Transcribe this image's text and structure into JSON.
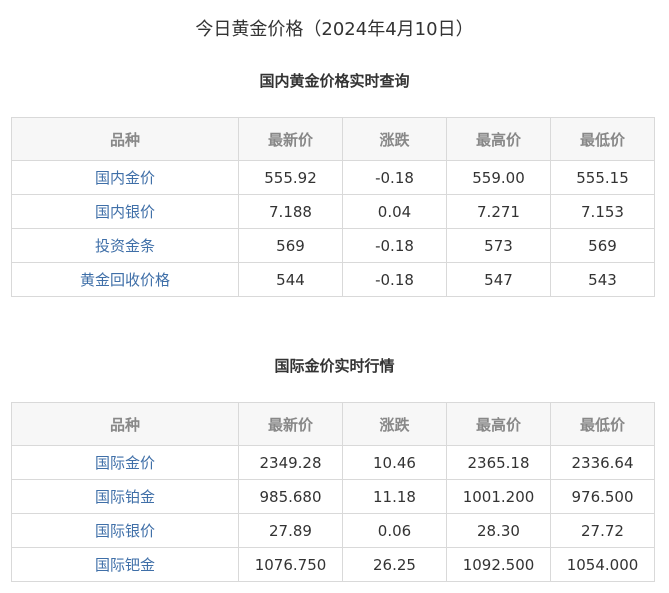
{
  "page_title": "今日黄金价格（2024年4月10日）",
  "domestic": {
    "title": "国内黄金价格实时查询",
    "headers": [
      "品种",
      "最新价",
      "涨跌",
      "最高价",
      "最低价"
    ],
    "rows": [
      [
        "国内金价",
        "555.92",
        "-0.18",
        "559.00",
        "555.15"
      ],
      [
        "国内银价",
        "7.188",
        "0.04",
        "7.271",
        "7.153"
      ],
      [
        "投资金条",
        "569",
        "-0.18",
        "573",
        "569"
      ],
      [
        "黄金回收价格",
        "544",
        "-0.18",
        "547",
        "543"
      ]
    ]
  },
  "international": {
    "title": "国际金价实时行情",
    "headers": [
      "品种",
      "最新价",
      "涨跌",
      "最高价",
      "最低价"
    ],
    "rows": [
      [
        "国际金价",
        "2349.28",
        "10.46",
        "2365.18",
        "2336.64"
      ],
      [
        "国际铂金",
        "985.680",
        "11.18",
        "1001.200",
        "976.500"
      ],
      [
        "国际银价",
        "27.89",
        "0.06",
        "28.30",
        "27.72"
      ],
      [
        "国际钯金",
        "1076.750",
        "26.25",
        "1092.500",
        "1054.000"
      ]
    ]
  },
  "colors": {
    "name_link": "#3f6fa8",
    "header_bg": "#f7f7f7",
    "header_text": "#888888",
    "border": "#d9d9d9",
    "text": "#333333"
  }
}
